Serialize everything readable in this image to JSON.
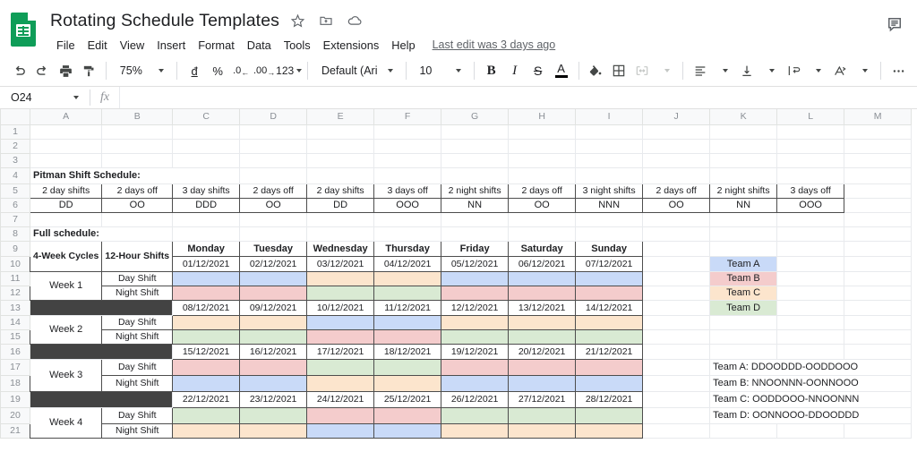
{
  "app": {
    "doc_title": "Rotating Schedule Templates",
    "last_edit": "Last edit was 3 days ago",
    "doc_icon": "sheets-icon",
    "title_icons": [
      "star-icon",
      "move-to-folder-icon",
      "cloud-saved-icon"
    ],
    "comment_icon": "comment-history-icon"
  },
  "menu": {
    "items": [
      "File",
      "Edit",
      "View",
      "Insert",
      "Format",
      "Data",
      "Tools",
      "Extensions",
      "Help"
    ]
  },
  "toolbar": {
    "undo": "undo-icon",
    "redo": "redo-icon",
    "print": "print-icon",
    "paint_format": "paint-format-icon",
    "zoom": "75%",
    "currency": "đ",
    "percent": "%",
    "decrease_decimal": ".0",
    "increase_decimal": ".00",
    "number_format": "123",
    "font": "Default (Ari...",
    "font_size": "10",
    "bold": "B",
    "italic": "I",
    "strikethrough": "S",
    "text_color": "A",
    "fill_color": "fill-color-icon",
    "borders": "borders-icon",
    "merge_cells": "merge-cells-icon",
    "horizontal_align": "horizontal-align-icon",
    "vertical_align": "vertical-align-icon",
    "text_wrap": "text-wrap-icon",
    "text_rotation": "text-rotation-icon",
    "more": "more-options-icon"
  },
  "formula_bar": {
    "name_box": "O24",
    "fx_label": "fx",
    "formula_value": ""
  },
  "grid": {
    "columns": [
      "A",
      "B",
      "C",
      "D",
      "E",
      "F",
      "G",
      "H",
      "I",
      "J",
      "K",
      "L",
      "M"
    ],
    "rows": [
      1,
      2,
      3,
      4,
      5,
      6,
      7,
      8,
      9,
      10,
      11,
      12,
      13,
      14,
      15,
      16,
      17,
      18,
      19,
      20,
      21
    ]
  },
  "sheet": {
    "pitman_title": "Pitman Shift Schedule:",
    "pitman_labels": [
      "2 day shifts",
      "2 days off",
      "3 day shifts",
      "2 days off",
      "2 day shifts",
      "3 days off",
      "2 night shifts",
      "2 days off",
      "3 night shifts",
      "2 days off",
      "2 night shifts",
      "3 days off"
    ],
    "pitman_codes": [
      "DD",
      "OO",
      "DDD",
      "OO",
      "DD",
      "OOO",
      "NN",
      "OO",
      "NNN",
      "OO",
      "NN",
      "OOO"
    ],
    "full_schedule_title": "Full schedule:",
    "cycles_header": "4-Week Cycles",
    "shifts_header": "12-Hour Shifts",
    "days": [
      "Monday",
      "Tuesday",
      "Wednesday",
      "Thursday",
      "Friday",
      "Saturday",
      "Sunday"
    ],
    "day_shift_label": "Day Shift",
    "night_shift_label": "Night Shift",
    "weeks": [
      {
        "label": "Week 1",
        "dates": [
          "01/12/2021",
          "02/12/2021",
          "03/12/2021",
          "04/12/2021",
          "05/12/2021",
          "06/12/2021",
          "07/12/2021"
        ],
        "day": [
          "blue",
          "blue",
          "yellow",
          "yellow",
          "blue",
          "blue",
          "blue"
        ],
        "night": [
          "red",
          "red",
          "green",
          "green",
          "red",
          "red",
          "red"
        ]
      },
      {
        "label": "Week 2",
        "dates": [
          "08/12/2021",
          "09/12/2021",
          "10/12/2021",
          "11/12/2021",
          "12/12/2021",
          "13/12/2021",
          "14/12/2021"
        ],
        "day": [
          "yellow",
          "yellow",
          "blue",
          "blue",
          "yellow",
          "yellow",
          "yellow"
        ],
        "night": [
          "green",
          "green",
          "red",
          "red",
          "green",
          "green",
          "green"
        ]
      },
      {
        "label": "Week 3",
        "dates": [
          "15/12/2021",
          "16/12/2021",
          "17/12/2021",
          "18/12/2021",
          "19/12/2021",
          "20/12/2021",
          "21/12/2021"
        ],
        "day": [
          "red",
          "red",
          "green",
          "green",
          "red",
          "red",
          "red"
        ],
        "night": [
          "blue",
          "blue",
          "yellow",
          "yellow",
          "blue",
          "blue",
          "blue"
        ]
      },
      {
        "label": "Week 4",
        "dates": [
          "22/12/2021",
          "23/12/2021",
          "24/12/2021",
          "25/12/2021",
          "26/12/2021",
          "27/12/2021",
          "28/12/2021"
        ],
        "day": [
          "green",
          "green",
          "red",
          "red",
          "green",
          "green",
          "green"
        ],
        "night": [
          "yellow",
          "yellow",
          "blue",
          "blue",
          "yellow",
          "yellow",
          "yellow"
        ]
      }
    ],
    "team_legend": [
      {
        "label": "Team A",
        "color": "blue"
      },
      {
        "label": "Team B",
        "color": "red"
      },
      {
        "label": "Team C",
        "color": "yellow"
      },
      {
        "label": "Team D",
        "color": "green"
      }
    ],
    "team_patterns": [
      "Team A: DDOODDD-OODDOOO",
      "Team B: NNOONNN-OONNOOO",
      "Team C: OODDOOO-NNOONNN",
      "Team D: OONNOOO-DDOODDD"
    ]
  },
  "colors": {
    "blue": "#c9daf8",
    "red": "#f4cccc",
    "yellow": "#fce5cd",
    "green": "#d9ead3",
    "dark_row": "#434343",
    "brand_green": "#0f9d58"
  }
}
